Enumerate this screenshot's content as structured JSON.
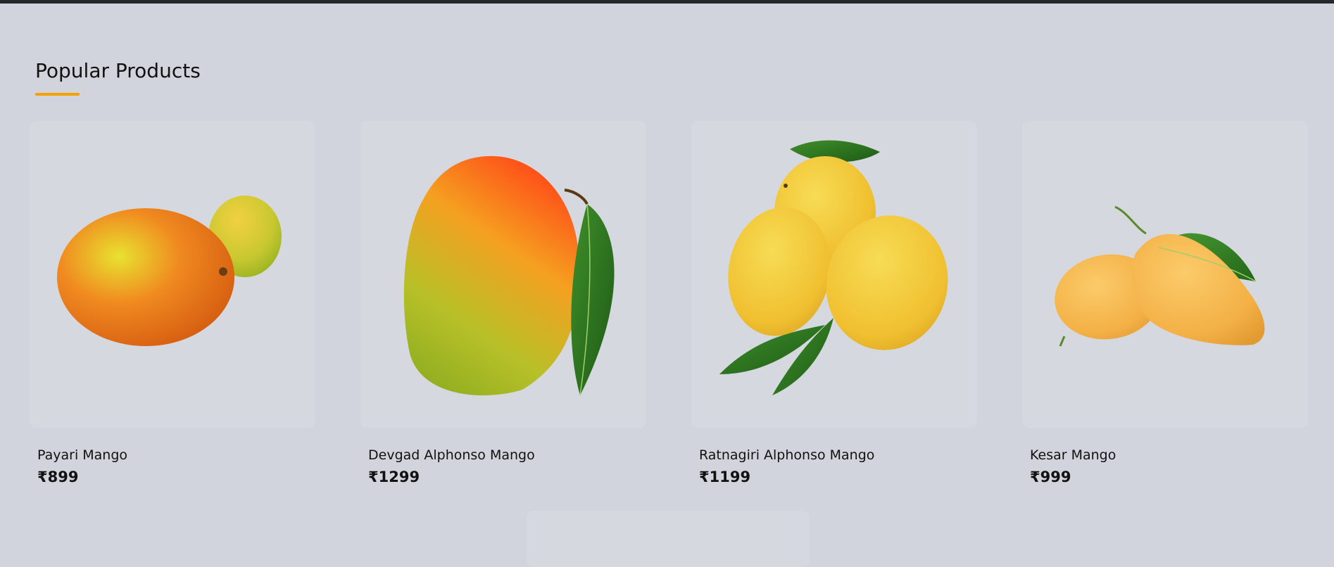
{
  "section": {
    "title": "Popular Products",
    "accent_color": "#f5a100"
  },
  "products": [
    {
      "name": "Payari Mango",
      "price": "₹899",
      "image_icon": "payari-mango-image"
    },
    {
      "name": "Devgad Alphonso Mango",
      "price": "₹1299",
      "image_icon": "devgad-alphonso-mango-image"
    },
    {
      "name": "Ratnagiri Alphonso Mango",
      "price": "₹1199",
      "image_icon": "ratnagiri-alphonso-mango-image"
    },
    {
      "name": "Kesar Mango",
      "price": "₹999",
      "image_icon": "kesar-mango-image"
    }
  ]
}
